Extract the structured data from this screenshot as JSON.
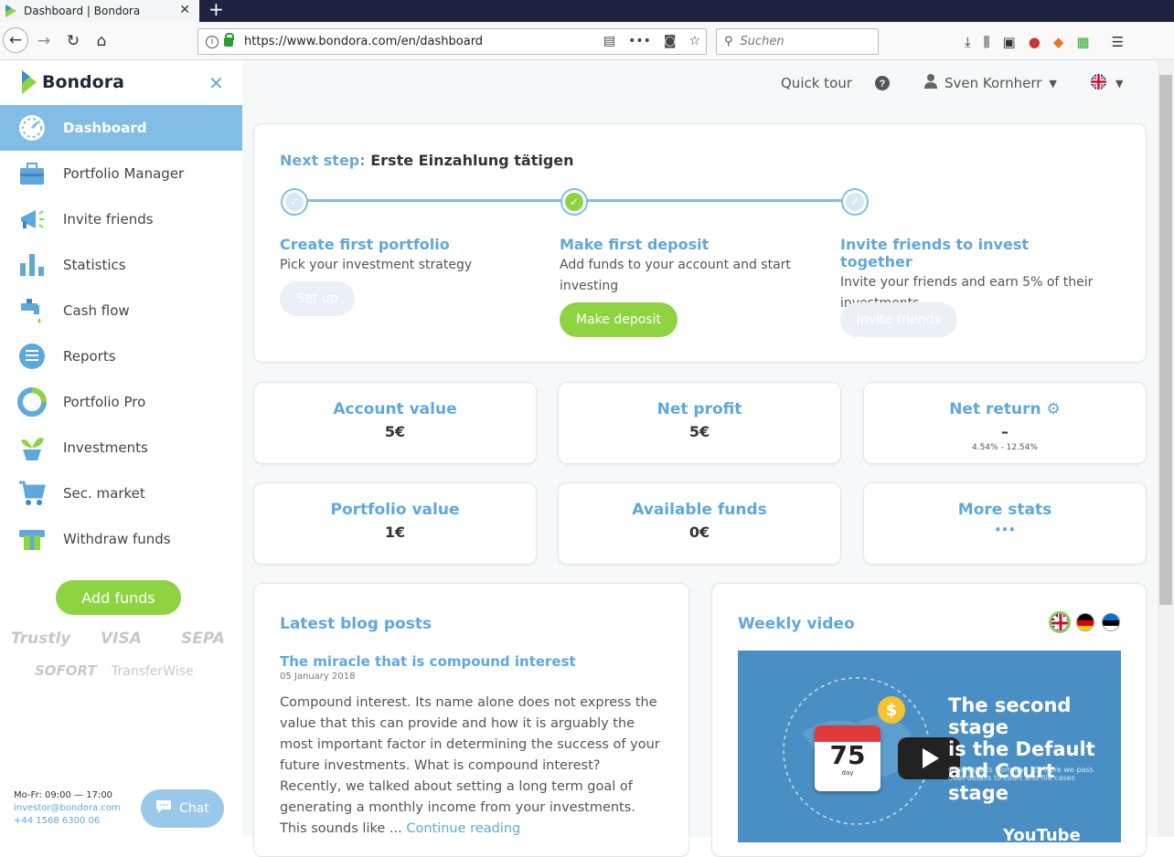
{
  "browser": {
    "tab_title": "Dashboard | Bondora",
    "url": "https://www.bondora.com/en/dashboard",
    "search_placeholder": "Suchen"
  },
  "sidebar": {
    "brand": "Bondora",
    "items": [
      {
        "label": "Dashboard",
        "icon": "speedometer-icon",
        "active": true
      },
      {
        "label": "Portfolio Manager",
        "icon": "briefcase-icon"
      },
      {
        "label": "Invite friends",
        "icon": "megaphone-icon"
      },
      {
        "label": "Statistics",
        "icon": "bar-chart-icon"
      },
      {
        "label": "Cash flow",
        "icon": "faucet-icon"
      },
      {
        "label": "Reports",
        "icon": "document-icon"
      },
      {
        "label": "Portfolio Pro",
        "icon": "pie-chart-icon"
      },
      {
        "label": "Investments",
        "icon": "plant-icon"
      },
      {
        "label": "Sec. market",
        "icon": "cart-icon"
      },
      {
        "label": "Withdraw funds",
        "icon": "atm-icon"
      }
    ],
    "add_funds": "Add funds",
    "payment_logos": [
      "Trustly",
      "VISA",
      "SEPA",
      "SOFORT",
      "TransferWise"
    ],
    "hours": "Mo-Fr: 09:00 — 17:00",
    "email": "investor@bondora.com",
    "phone": "+44 1568 6300 06",
    "chat": "Chat"
  },
  "topnav": {
    "quick_tour": "Quick tour",
    "user": "Sven Kornherr"
  },
  "steps": {
    "prefix": "Next step:",
    "title": "Erste Einzahlung tätigen",
    "items": [
      {
        "title": "Create first portfolio",
        "desc": "Pick your investment strategy",
        "button": "Set up",
        "done": false
      },
      {
        "title": "Make first deposit",
        "desc": "Add funds to your account and start investing",
        "button": "Make deposit",
        "done": true
      },
      {
        "title": "Invite friends to invest together",
        "desc": "Invite your friends and earn 5% of their investments",
        "button": "Invite friends",
        "done": false
      }
    ]
  },
  "stats": [
    {
      "label": "Account value",
      "value": "5€"
    },
    {
      "label": "Net profit",
      "value": "5€"
    },
    {
      "label": "Net return",
      "value": "–",
      "sub": "4.54% - 12.54%"
    },
    {
      "label": "Portfolio value",
      "value": "1€"
    },
    {
      "label": "Available funds",
      "value": "0€"
    },
    {
      "label": "More stats",
      "value": "•••"
    }
  ],
  "blog": {
    "heading": "Latest blog posts",
    "post_title": "The miracle that is compound interest",
    "post_date": "05 January 2018",
    "post_body": "Compound interest. Its name alone does not express the value that this can provide and how it is arguably the most important factor in determining the success of your future investments. What is compound interest? Recently, we talked about setting a long term goal of generating a monthly income from your investments. This sounds like ... ",
    "more": "Continue reading"
  },
  "video": {
    "heading": "Weekly video",
    "title_line1": "The second stage",
    "title_line2": "is the Default",
    "title_line3": "and Court stage",
    "subtitle": "which starts from day 75. Here we pass debt details to court and file cases",
    "calendar_number": "75",
    "calendar_unit": "day",
    "youtube": "YouTube"
  }
}
